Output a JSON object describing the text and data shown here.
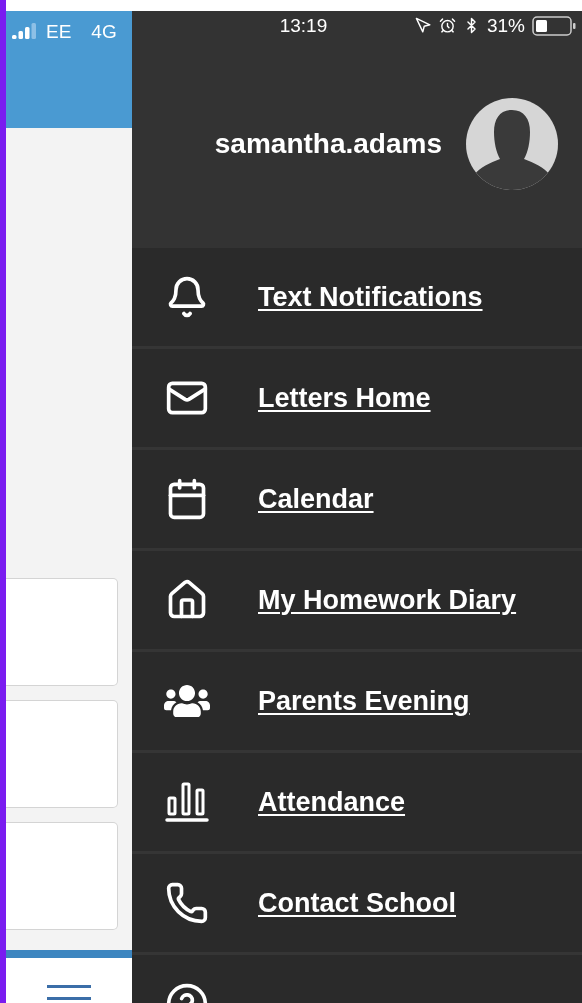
{
  "status_bar": {
    "carrier": "EE",
    "network": "4G",
    "time": "13:19",
    "battery": "31%"
  },
  "profile": {
    "username": "samantha.adams"
  },
  "menu": [
    {
      "label": "Text Notifications",
      "kind": "bell"
    },
    {
      "label": "Letters Home",
      "kind": "mail"
    },
    {
      "label": "Calendar",
      "kind": "calendar"
    },
    {
      "label": "My Homework Diary",
      "kind": "house"
    },
    {
      "label": "Parents Evening",
      "kind": "people"
    },
    {
      "label": "Attendance",
      "kind": "bars"
    },
    {
      "label": "Contact School",
      "kind": "phone"
    },
    {
      "kind": "question"
    }
  ]
}
